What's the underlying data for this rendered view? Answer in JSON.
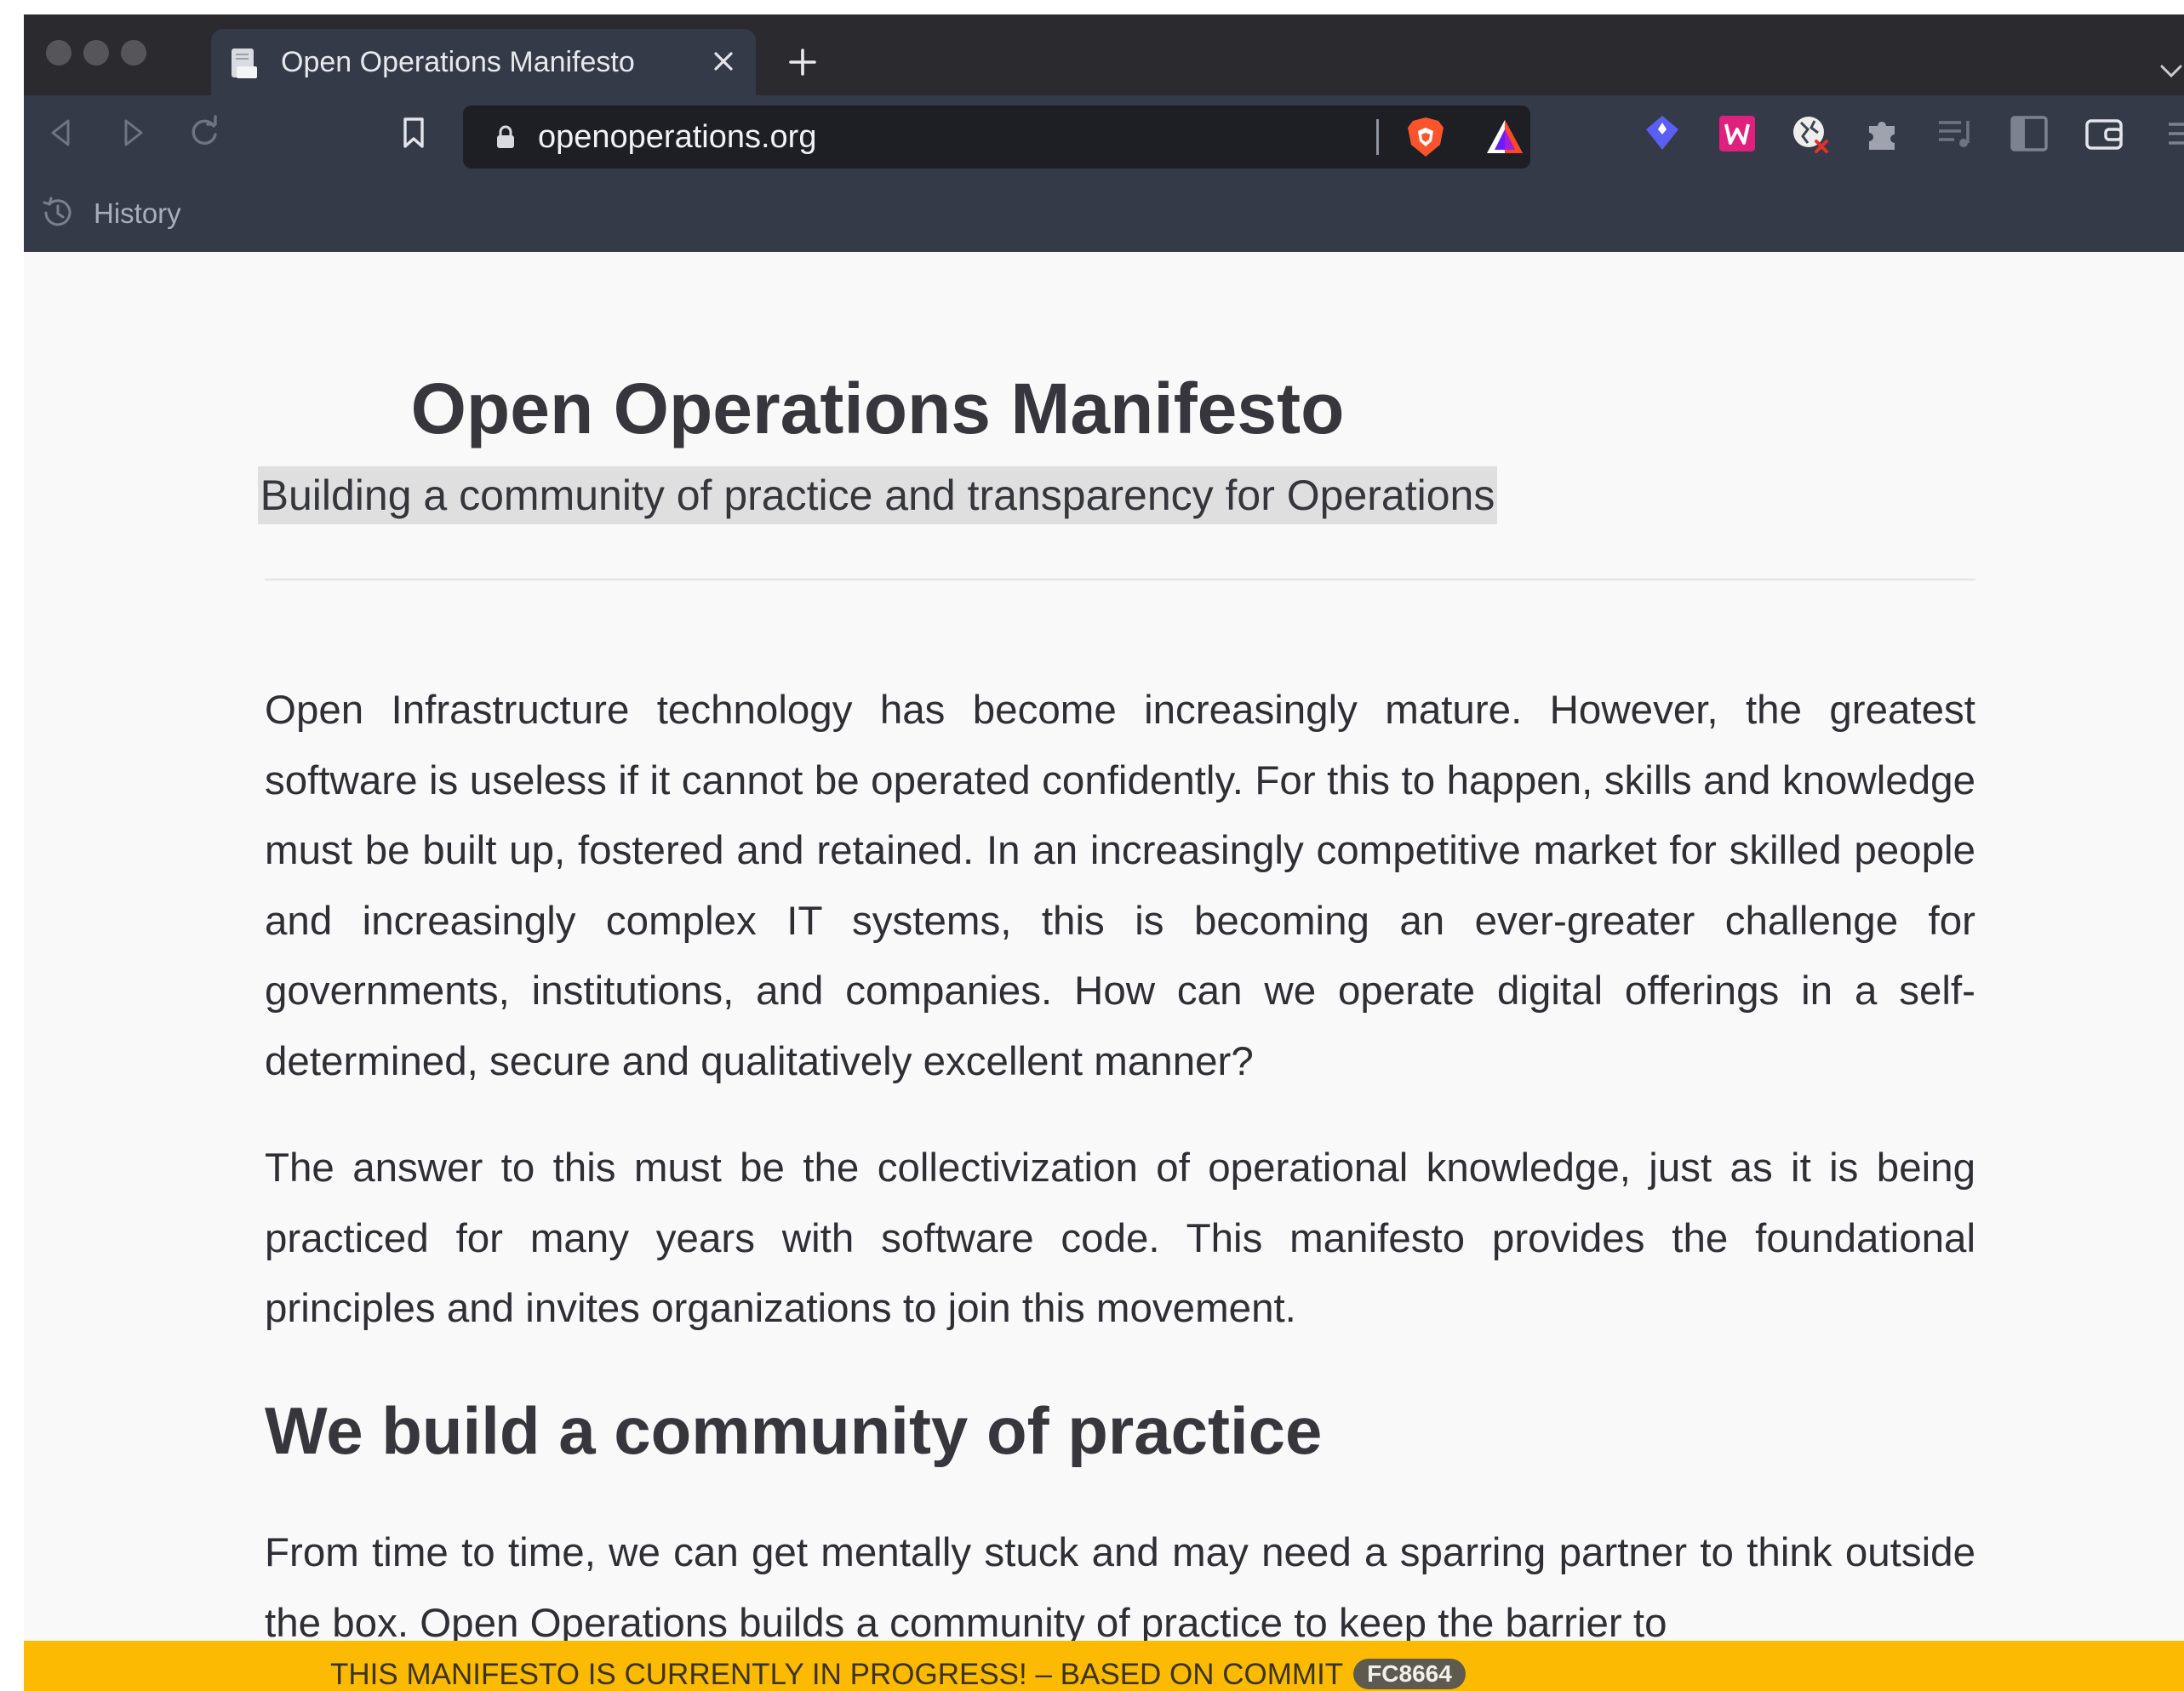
{
  "browser": {
    "tab": {
      "title": "Open Operations Manifesto"
    },
    "address": {
      "url": "openoperations.org"
    },
    "bookmarks": {
      "history_label": "History"
    },
    "icons": [
      "back-icon",
      "forward-icon",
      "reload-icon",
      "bookmark-icon",
      "lock-icon",
      "brave-shields-icon",
      "brave-rewards-icon",
      "extension-diamond-icon",
      "extension-w-icon",
      "extension-globe-icon",
      "extensions-puzzle-icon",
      "playlist-icon",
      "sidebar-icon",
      "wallet-icon",
      "menu-icon"
    ],
    "colors": {
      "tabstrip": "#2b2a2e",
      "toolbar": "#343a48",
      "urlbar": "#1d1f25"
    }
  },
  "page": {
    "title": "Open Operations Manifesto",
    "subtitle": "Building a community of practice and transparency for Operations",
    "paragraphs": [
      "Open Infrastructure technology has become increasingly mature. However, the greatest software is useless if it cannot be operated confidently. For this to happen, skills and knowledge must be built up, fostered and retained. In an increasingly competitive market for skilled people and increasingly complex IT systems, this is becoming an ever-greater challenge for governments, institutions, and companies. How can we operate digital offerings in a self-determined, secure and qualitatively excellent manner?",
      "The answer to this must be the collectivization of operational knowledge, just as it is being practiced for many years with software code. This manifesto provides the foundational principles and invites organizations to join this movement."
    ],
    "section_heading": "We build a community of practice",
    "section_paragraph": "From time to time, we can get mentally stuck and may need a sparring partner to think outside the box. Open Operations builds a community of practice to keep the barrier to"
  },
  "banner": {
    "text": "THIS MANIFESTO IS CURRENTLY IN PROGRESS! – BASED ON COMMIT",
    "commit": "FC8664",
    "color": "#fcbb02"
  }
}
